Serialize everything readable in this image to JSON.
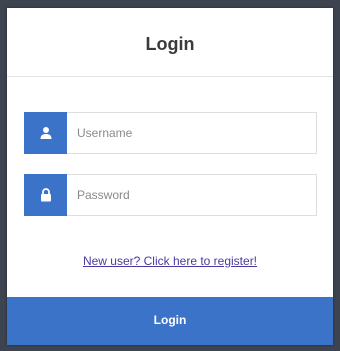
{
  "card": {
    "title": "Login"
  },
  "username": {
    "icon": "user-icon",
    "placeholder": "Username",
    "value": ""
  },
  "password": {
    "icon": "lock-icon",
    "placeholder": "Password",
    "value": ""
  },
  "register_link": "New user? Click here to register!",
  "login_button": "Login",
  "colors": {
    "accent": "#3b73c8",
    "background": "#3d4450",
    "card": "#ffffff",
    "link": "#4a3aa0"
  }
}
